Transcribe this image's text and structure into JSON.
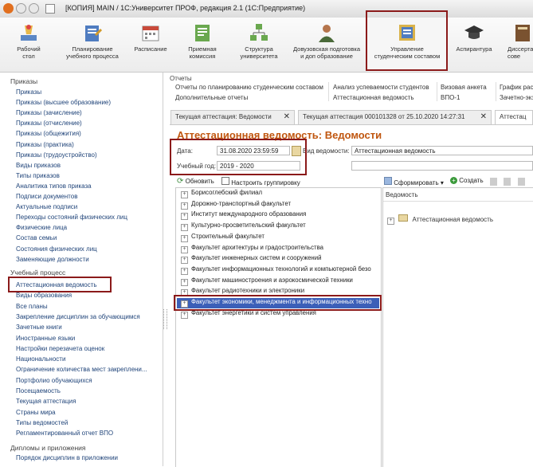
{
  "window": {
    "title": "[КОПИЯ] MAIN / 1С:Университет ПРОФ, редакция 2.1  (1С:Предприятие)"
  },
  "sections": [
    {
      "label": "Рабочий\nстол",
      "icon": "desktop-icon"
    },
    {
      "label": "Планирование\nучебного процесса",
      "icon": "planning-icon"
    },
    {
      "label": "Расписание",
      "icon": "calendar-icon"
    },
    {
      "label": "Приемная\nкомиссия",
      "icon": "admission-icon"
    },
    {
      "label": "Структура\nуниверситета",
      "icon": "structure-icon"
    },
    {
      "label": "Довузовская подготовка\nи доп образование",
      "icon": "person-icon"
    },
    {
      "label": "Управление\nстуденческим составом",
      "icon": "students-icon"
    },
    {
      "label": "Аспирантура",
      "icon": "graduate-cap-icon"
    },
    {
      "label": "Диссерта\nсове",
      "icon": "dissertation-icon"
    }
  ],
  "subnav": {
    "reports_heading": "Отчеты",
    "row1": [
      "Отчеты по планированию студенческим составом",
      "Анализ успеваемости студентов",
      "Визовая анкета",
      "График рас"
    ],
    "row2": [
      "Дополнительные отчеты",
      "Аттестационная ведомость",
      "ВПО-1",
      "Зачетно-экз"
    ]
  },
  "tabs": [
    {
      "label": "Текущая аттестация: Ведомости"
    },
    {
      "label": "Текущая аттестация 000101328 от 25.10.2020 14:27:31"
    },
    {
      "label": "Аттестац"
    }
  ],
  "leftnav": {
    "heading1": "Приказы",
    "orders": [
      "Приказы",
      "Приказы (высшее образование)",
      "Приказы (зачисление)",
      "Приказы (отчисление)",
      "Приказы (общежития)",
      "Приказы (практика)",
      "Приказы (трудоустройство)",
      "Виды приказов",
      "Типы приказов",
      "Аналитика типов приказа",
      "Подписи документов",
      "Актуальные подписи",
      "Переходы состояний физических лиц",
      "Физические лица",
      "Состав семьи",
      "Состояния физических лиц",
      "Заменяющие должности"
    ],
    "heading2": "Учебный процесс",
    "process": [
      "Аттестационная ведомость",
      "Виды образования",
      "Все планы",
      "Закрепление дисциплин за обучающимся",
      "Зачетные книги",
      "Иностранные языки",
      "Настройки перезачета оценок",
      "Национальности",
      "Ограничение количества мест закреплени...",
      "Портфолио обучающихся",
      "Посещаемость",
      "Текущая аттестация",
      "Страны мира",
      "Типы ведомостей",
      "Регламентированный отчет ВПО"
    ],
    "heading3": "Дипломы и приложения",
    "diplomas": [
      "Порядок дисциплин в приложении"
    ]
  },
  "form": {
    "title": "Аттестационная ведомость: Ведомости",
    "date_label": "Дата:",
    "date_value": "31.08.2020 23:59:59",
    "year_label": "Учебный год:",
    "year_value": "2019 - 2020",
    "kind_label": "Вид ведомости:",
    "kind_value": "Аттестационная ведомость"
  },
  "toolbar_left": {
    "refresh": "Обновить",
    "grouping": "Настроить группировку"
  },
  "toolbar_right": {
    "generate": "Сформировать",
    "create": "Создать"
  },
  "tree": [
    "Борисоглебский филиал",
    "Дорожно-транспортный факультет",
    "Институт международного образования",
    "Культурно-просветительский факультет",
    "Строительный факультет",
    "Факультет архитектуры и градостроительства",
    "Факультет инженерных систем и сооружений",
    "Факультет информационных технологий и компьютерной безо",
    "Факультет машиностроения и аэрокосмической техники",
    "Факультет радиотехники и электроники",
    "Факультет экономики, менеджмента и информационных техно",
    "Факультет энергетики и систем управления"
  ],
  "right_panel": {
    "header": "Ведомость",
    "item": "Аттестационная ведомость"
  },
  "colors": {
    "accent_red": "#8b1a1a",
    "title_orange": "#c0560f",
    "link_blue": "#21457a",
    "selection": "#3b5fb8"
  }
}
